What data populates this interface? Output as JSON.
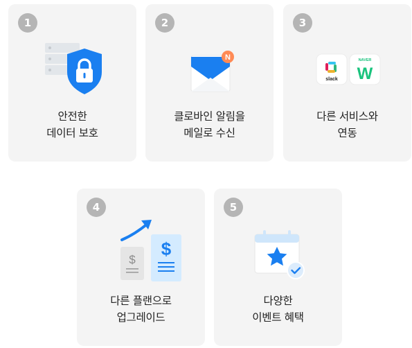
{
  "cards": [
    {
      "number": "1",
      "line1": "안전한",
      "line2": "데이터 보호",
      "icon": "shield-lock-icon"
    },
    {
      "number": "2",
      "line1": "클로바인 알림을",
      "line2": "메일로 수신",
      "icon": "mail-notification-icon",
      "notif_letter": "N"
    },
    {
      "number": "3",
      "line1": "다른 서비스와",
      "line2": "연동",
      "icon": "integration-icons",
      "slack_label": "slack",
      "naver_label": "NAVER",
      "works_letter": "W"
    },
    {
      "number": "4",
      "line1": "다른 플랜으로",
      "line2": "업그레이드",
      "icon": "upgrade-plan-icon",
      "small_currency": "$",
      "big_currency": "$"
    },
    {
      "number": "5",
      "line1": "다양한",
      "line2": "이벤트 혜택",
      "icon": "calendar-star-icon"
    }
  ],
  "colors": {
    "card_bg": "#f4f4f4",
    "badge_bg": "#b5b5b5",
    "accent_blue": "#1a7ff0",
    "text": "#222222"
  }
}
